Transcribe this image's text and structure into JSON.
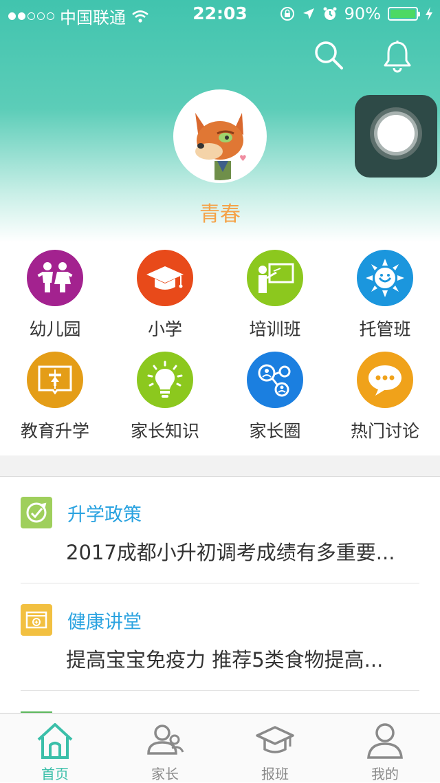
{
  "status_bar": {
    "carrier": "中国联通",
    "time": "22:03",
    "battery_percent": "90%",
    "signal_bars": 2,
    "battery_level": 0.9
  },
  "header": {
    "nickname": "青春",
    "icons": [
      "search-icon",
      "bell-icon"
    ],
    "gradient_colors": [
      "#41c4ae",
      "#ffffff"
    ]
  },
  "categories": [
    {
      "label": "幼儿园",
      "color": "#a3228f",
      "icon": "children-icon"
    },
    {
      "label": "小学",
      "color": "#e84a1a",
      "icon": "graduation-cap-icon"
    },
    {
      "label": "培训班",
      "color": "#8cc81e",
      "icon": "teacher-board-icon"
    },
    {
      "label": "托管班",
      "color": "#1b96dd",
      "icon": "sun-face-icon"
    },
    {
      "label": "教育升学",
      "color": "#e49d17",
      "icon": "book-upload-icon"
    },
    {
      "label": "家长知识",
      "color": "#8cc81e",
      "icon": "lightbulb-icon"
    },
    {
      "label": "家长圈",
      "color": "#1b7fe0",
      "icon": "people-network-icon"
    },
    {
      "label": "热门讨论",
      "color": "#f0a21a",
      "icon": "chat-bubble-icon"
    }
  ],
  "news": [
    {
      "category": "升学政策",
      "title": "2017成都小升初调考成绩有多重要...",
      "icon_color": "#9fcf5c",
      "icon": "policy-icon"
    },
    {
      "category": "健康讲堂",
      "title": "提高宝宝免疫力 推荐5类食物提高...",
      "icon_color": "#f2c041",
      "icon": "health-lecture-icon"
    }
  ],
  "tabs": [
    {
      "label": "首页",
      "icon": "home-icon",
      "active": true
    },
    {
      "label": "家长",
      "icon": "parents-icon",
      "active": false
    },
    {
      "label": "报班",
      "icon": "graduation-cap-icon",
      "active": false
    },
    {
      "label": "我的",
      "icon": "profile-icon",
      "active": false
    }
  ],
  "colors": {
    "accent": "#3bbfa9",
    "nickname": "#f5a247",
    "news_category": "#2ba3e0"
  }
}
